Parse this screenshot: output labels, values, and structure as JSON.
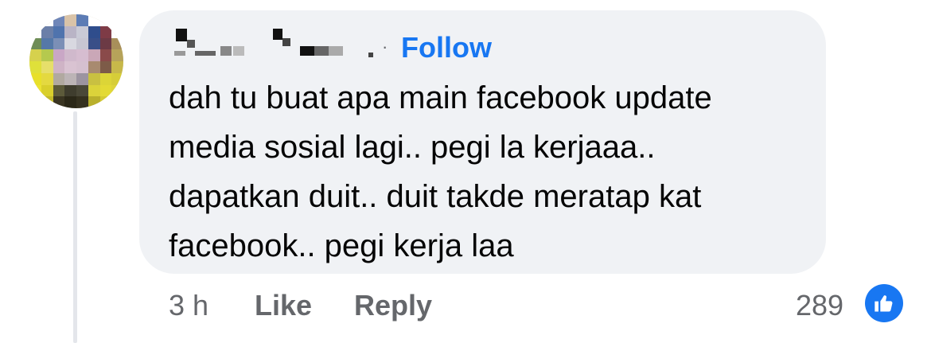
{
  "comment": {
    "author_display": "redacted",
    "separator": "·",
    "follow_label": "Follow",
    "text_lines": [
      "dah tu buat apa main facebook update",
      "media sosial lagi.. pegi la kerjaaa..",
      "dapatkan duit.. duit takde meratap kat",
      "facebook.. pegi kerja laa"
    ]
  },
  "actions": {
    "time": "3 h",
    "like_label": "Like",
    "reply_label": "Reply",
    "reaction_count": "289",
    "reaction_icon": "thumbs-up-icon"
  },
  "colors": {
    "accent": "#1877f2",
    "bubble": "#f0f2f5",
    "meta_text": "#65676b",
    "body_text": "#050505"
  }
}
